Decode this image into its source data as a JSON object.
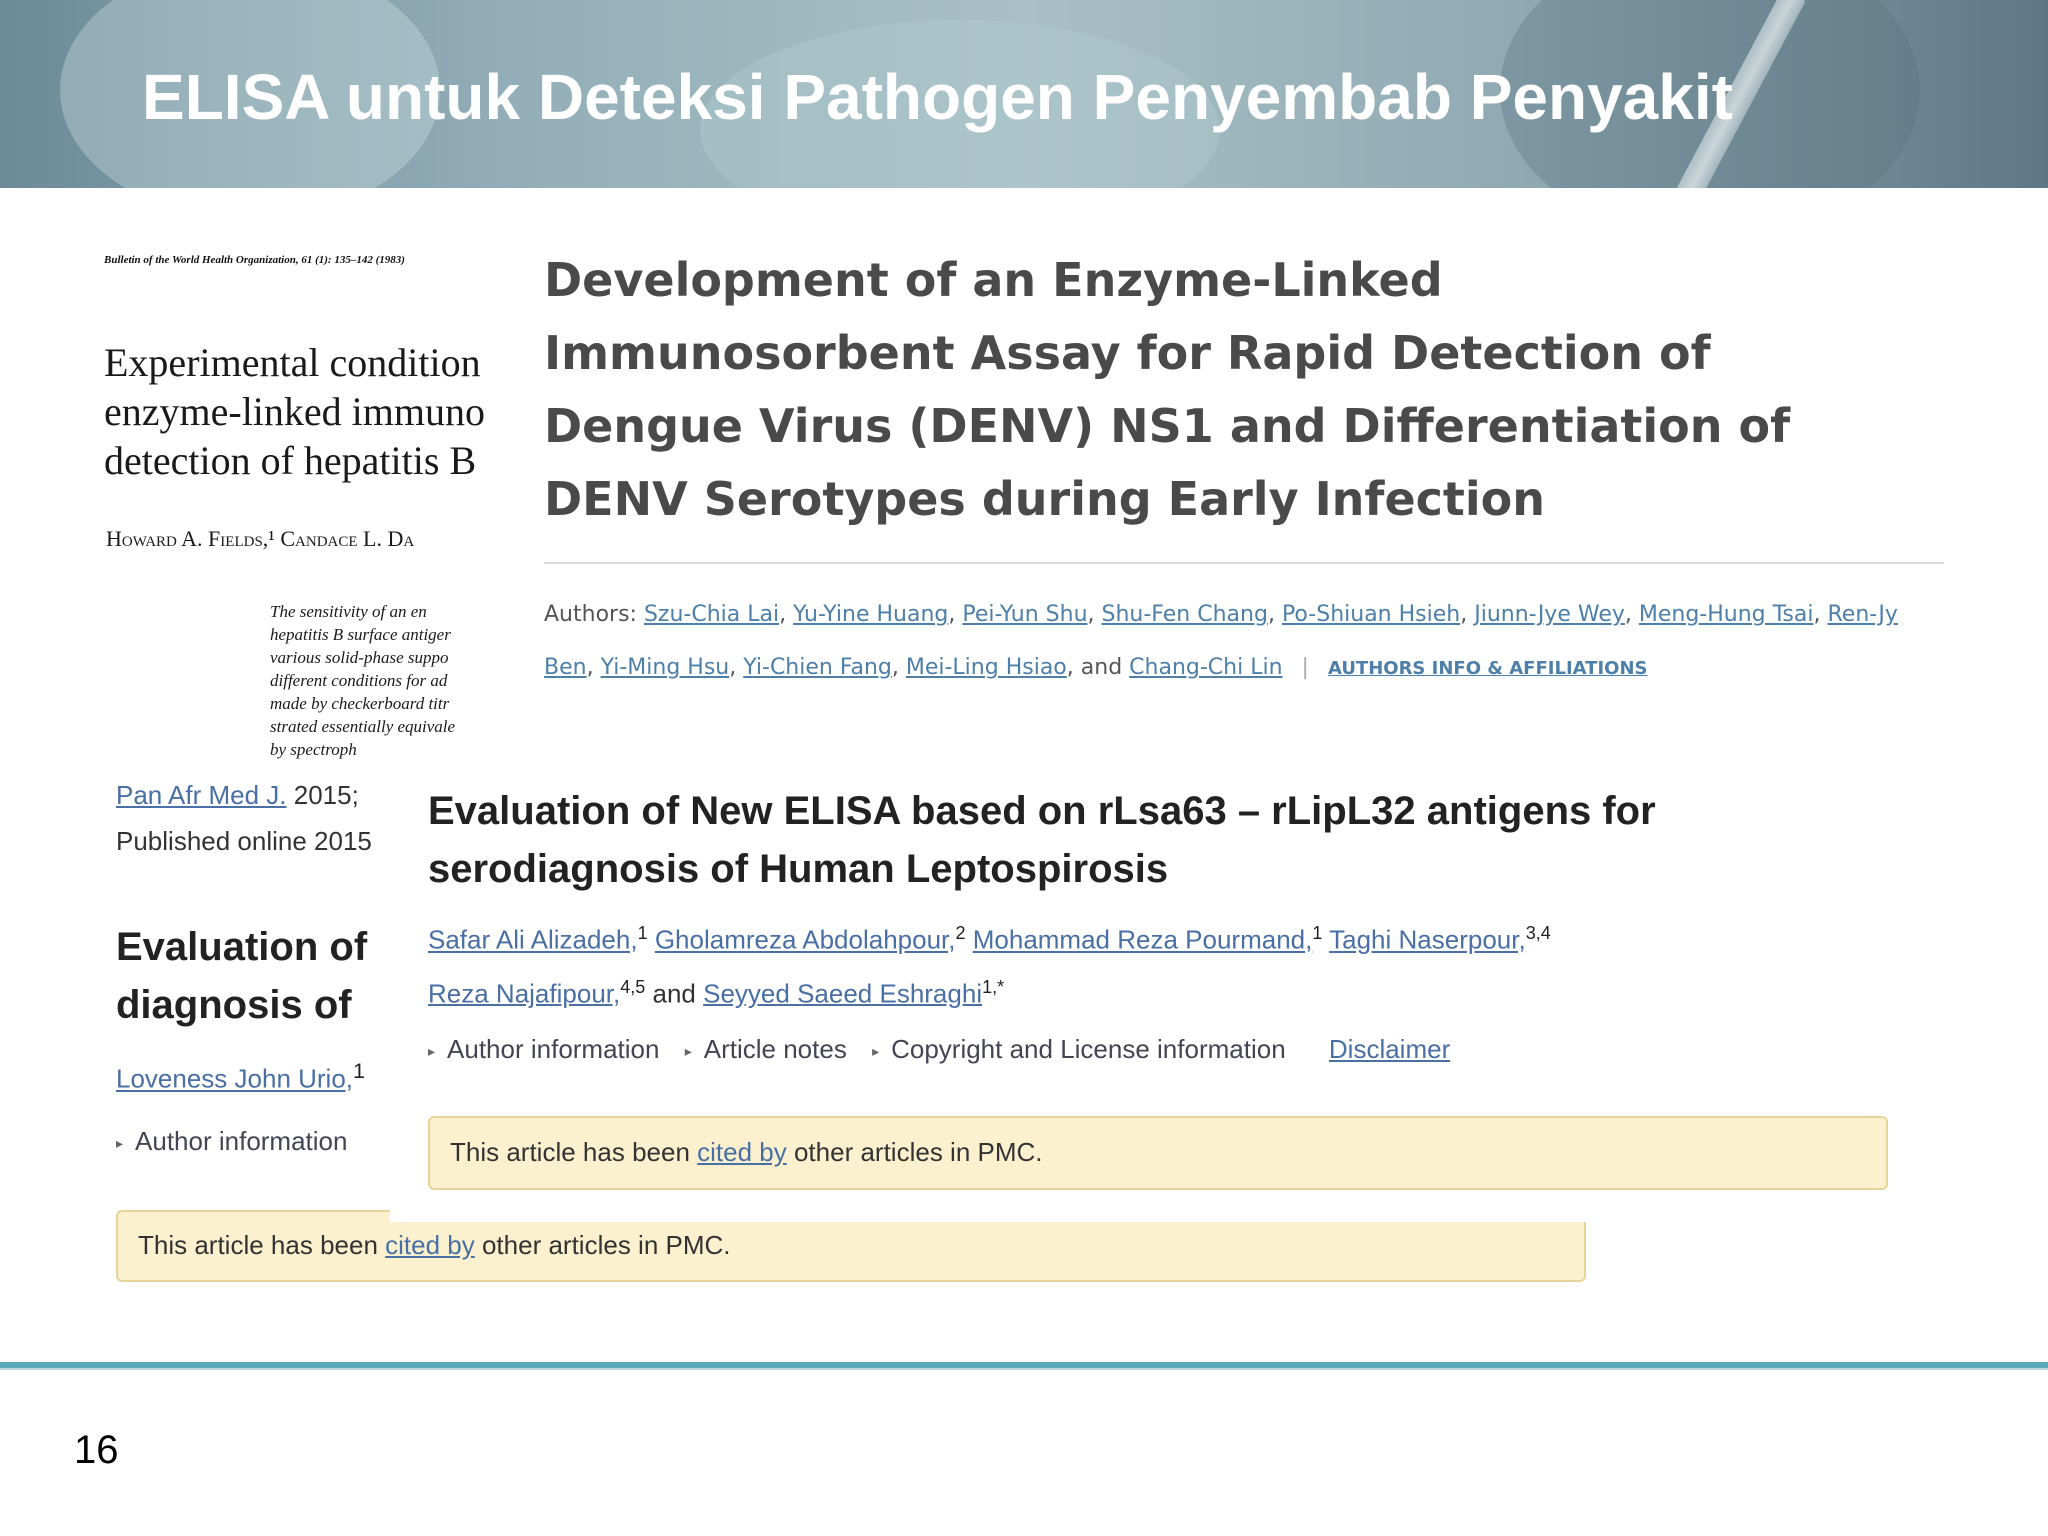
{
  "slide": {
    "title": "ELISA untuk Deteksi Pathogen Penyembab Penyakit",
    "page_number": "16"
  },
  "paper1": {
    "journal": "Bulletin of the World Health Organization, 61 (1): 135–142 (1983)",
    "title_lines": [
      "Experimental condition",
      "enzyme-linked immuno",
      "detection of hepatitis B"
    ],
    "authors": "Howard A. Fields,¹ Candace L. Da",
    "abstract_lines": [
      "The sensitivity of an en",
      "hepatitis B surface antiger",
      "various solid-phase suppo",
      "different conditions for ad",
      "made by checkerboard titr",
      "strated essentially equivale",
      "by spectroph"
    ]
  },
  "paper2": {
    "title_lines": [
      "Development of an Enzyme-Linked",
      "Immunosorbent Assay for Rapid Detection of",
      "Dengue Virus (DENV) NS1 and Differentiation of",
      "DENV Serotypes during Early Infection"
    ],
    "authors_label": "Authors:",
    "authors": [
      "Szu-Chia Lai",
      "Yu-Yine Huang",
      "Pei-Yun Shu",
      "Shu-Fen Chang",
      "Po-Shiuan Hsieh",
      "Jiunn-Jye Wey",
      "Meng-Hung Tsai",
      "Ren-Jy Ben",
      "Yi-Ming Hsu",
      "Yi-Chien Fang",
      "Mei-Ling Hsiao"
    ],
    "and_text": "and",
    "last_author": "Chang-Chi Lin",
    "separator": "|",
    "info_link": "AUTHORS INFO & AFFILIATIONS"
  },
  "paper3": {
    "journal_link": "Pan Afr Med J.",
    "journal_rest": " 2015;",
    "published": "Published online 2015",
    "title_lines": [
      "Evaluation of",
      "diagnosis of"
    ],
    "author": "Loveness John Urio,",
    "author_sup": "1",
    "author_info": "Author information",
    "cited_pre": "This article has been ",
    "cited_link": "cited by",
    "cited_post": " other articles in PMC."
  },
  "paper4": {
    "title_lines": [
      "Evaluation of New ELISA based on rLsa63 – rLipL32 antigens for",
      "serodiagnosis of Human Leptospirosis"
    ],
    "authors": [
      {
        "name": "Safar Ali Alizadeh,",
        "sup": "1"
      },
      {
        "name": "Gholamreza Abdolahpour,",
        "sup": "2"
      },
      {
        "name": "Mohammad Reza Pourmand,",
        "sup": "1"
      },
      {
        "name": "Taghi Naserpour,",
        "sup": "3,4"
      },
      {
        "name": "Reza Najafipour,",
        "sup": "4,5"
      },
      {
        "name": "Seyyed Saeed Eshraghi",
        "sup": "1,*"
      }
    ],
    "and_text": "and",
    "links": [
      "Author information",
      "Article notes",
      "Copyright and License information"
    ],
    "disclaimer": "Disclaimer",
    "cited_pre": "This article has been ",
    "cited_link": "cited by",
    "cited_post": " other articles in PMC."
  },
  "colors": {
    "link": "#4a6fa5",
    "cited_box_bg": "#fbf1cf",
    "cited_box_border": "#e5d59b",
    "footer_rule": "#5aaabb",
    "title_text": "#ffffff"
  }
}
